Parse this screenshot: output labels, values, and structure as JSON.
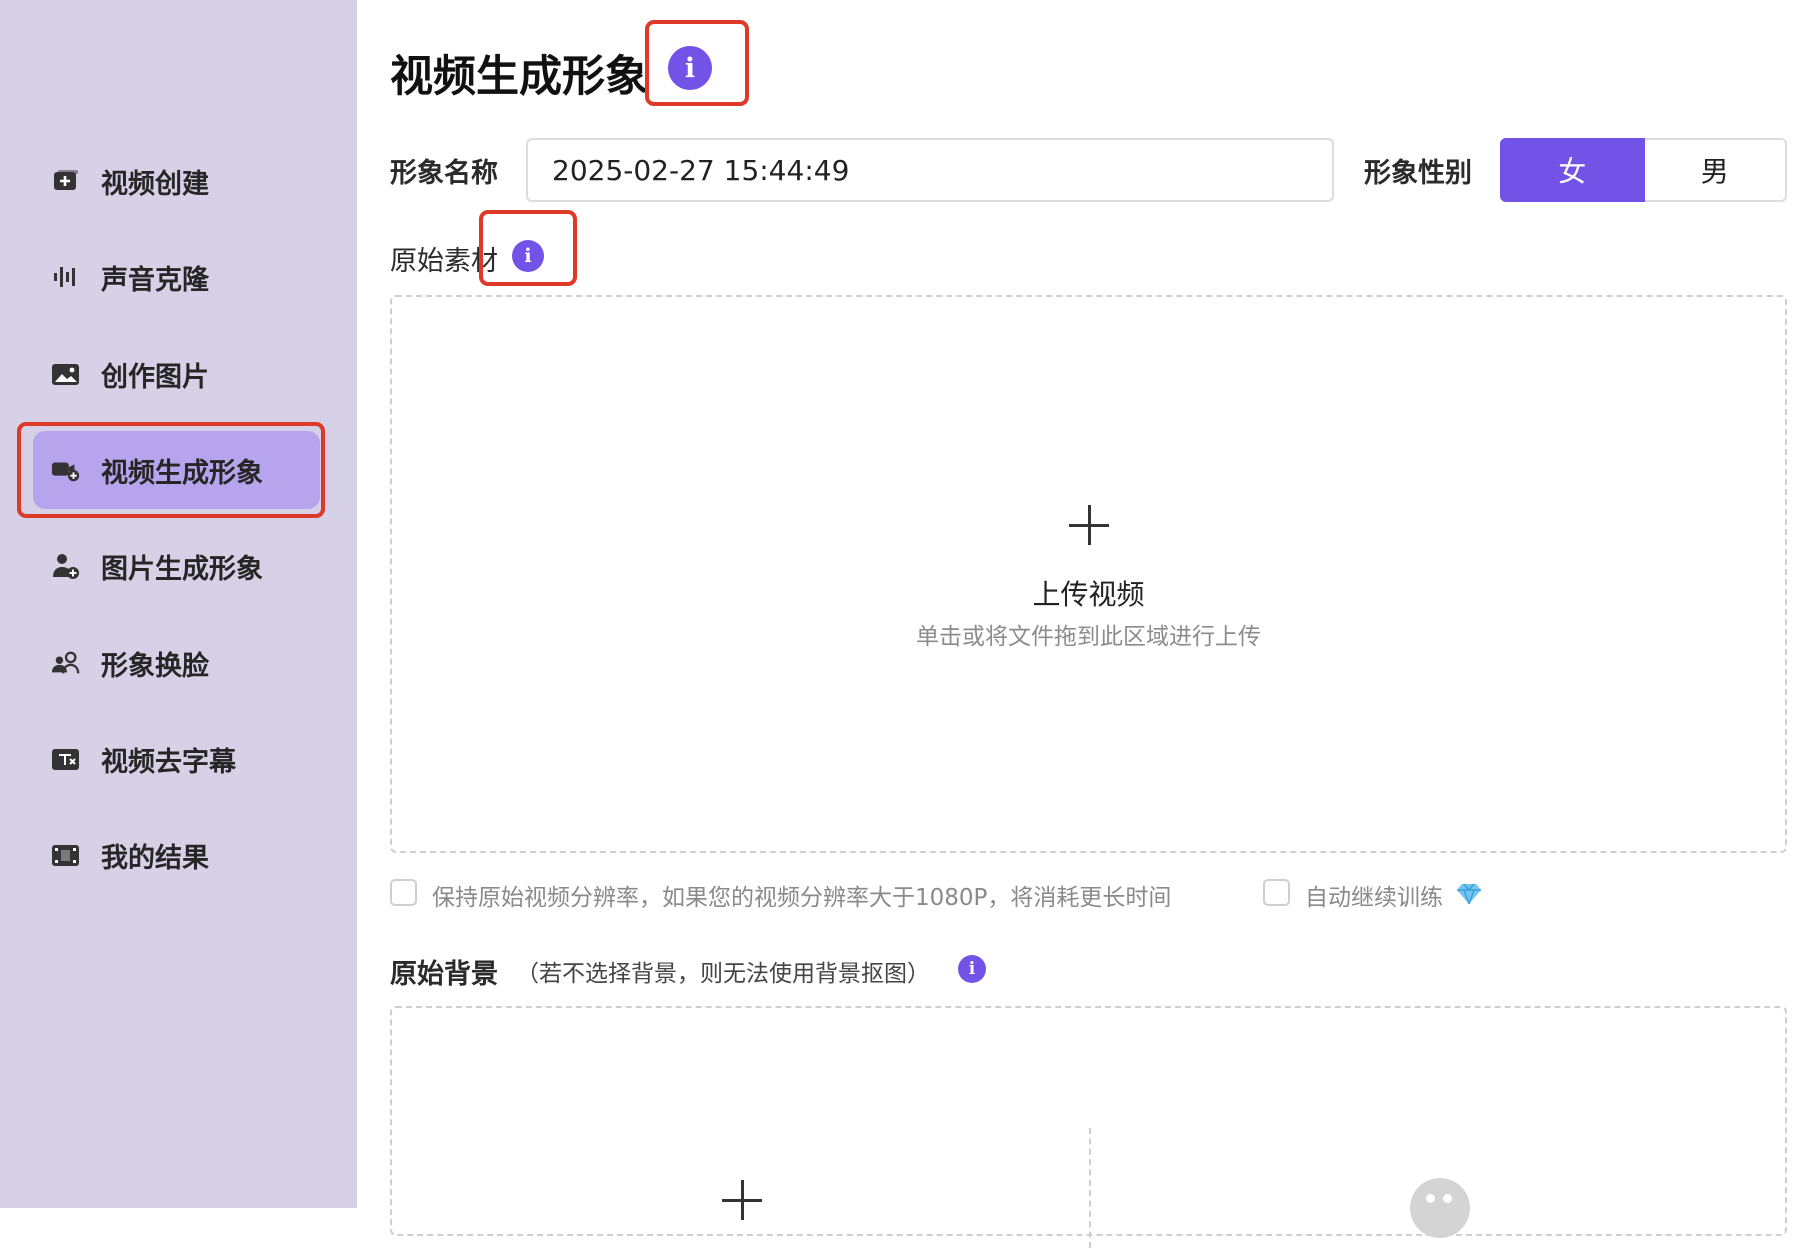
{
  "sidebar": {
    "items": [
      {
        "label": "视频创建",
        "icon": "video-add-icon"
      },
      {
        "label": "声音克隆",
        "icon": "audio-wave-icon"
      },
      {
        "label": "创作图片",
        "icon": "image-icon"
      },
      {
        "label": "视频生成形象",
        "icon": "video-camera-add-icon",
        "active": true
      },
      {
        "label": "图片生成形象",
        "icon": "user-add-icon"
      },
      {
        "label": "形象换脸",
        "icon": "face-swap-icon"
      },
      {
        "label": "视频去字幕",
        "icon": "subtitle-remove-icon"
      },
      {
        "label": "我的结果",
        "icon": "film-results-icon"
      }
    ]
  },
  "main": {
    "title": "视频生成形象",
    "name_label": "形象名称",
    "name_value": "2025-02-27 15:44:49",
    "gender_label": "形象性别",
    "gender_options": [
      "女",
      "男"
    ],
    "gender_selected": "女",
    "source_label": "原始素材",
    "upload": {
      "title": "上传视频",
      "hint": "单击或将文件拖到此区域进行上传"
    },
    "options": {
      "keep_resolution": "保持原始视频分辨率，如果您的视频分辨率大于1080P，将消耗更长时间",
      "auto_train": "自动继续训练",
      "auto_train_icon": "diamond-icon"
    },
    "background_label": "原始背景",
    "background_note": "（若不选择背景，则无法使用背景抠图）"
  },
  "colors": {
    "accent": "#7352e8",
    "sidebar_bg": "#d6d1e6",
    "active_item_bg": "#b6a5ec",
    "highlight_box": "#dd3a2a"
  }
}
